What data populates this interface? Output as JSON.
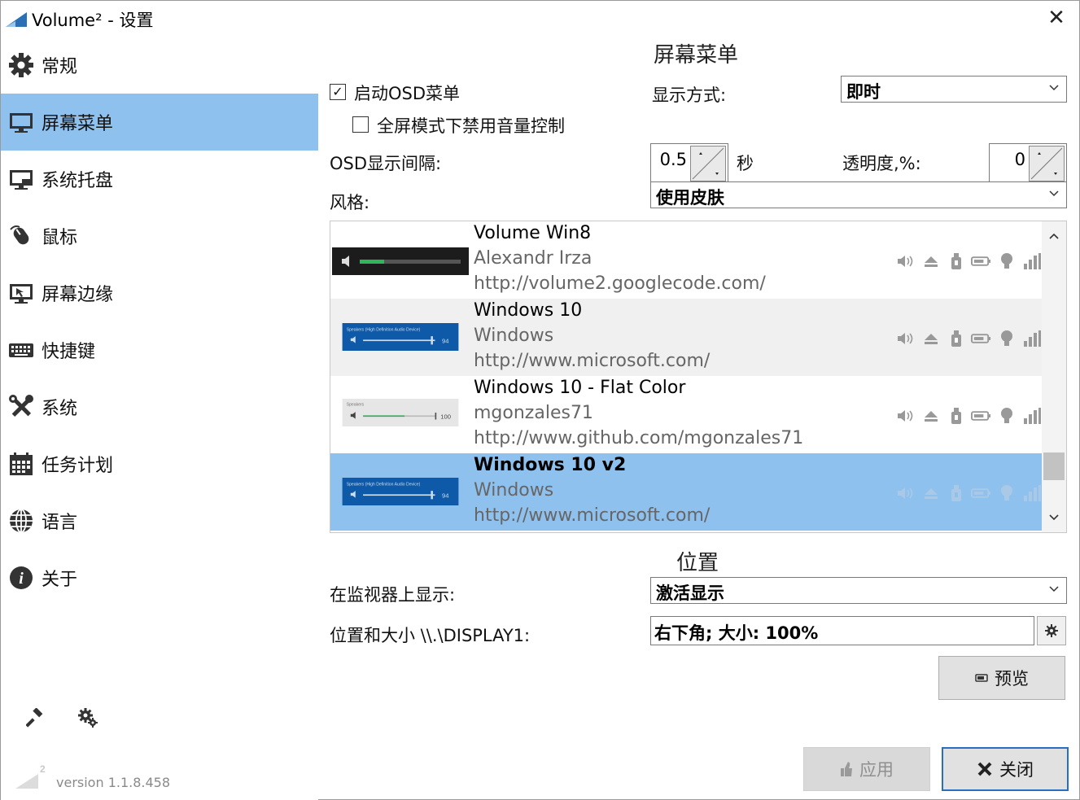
{
  "window": {
    "title": "Volume² - 设置",
    "close_label": "✕"
  },
  "sidebar": {
    "items": [
      {
        "label": "常规",
        "icon": "gear-icon"
      },
      {
        "label": "屏幕菜单",
        "icon": "monitor-icon"
      },
      {
        "label": "系统托盘",
        "icon": "tray-icon"
      },
      {
        "label": "鼠标",
        "icon": "mouse-icon"
      },
      {
        "label": "屏幕边缘",
        "icon": "screen-edge-icon"
      },
      {
        "label": "快捷键",
        "icon": "keyboard-icon"
      },
      {
        "label": "系统",
        "icon": "tools-icon"
      },
      {
        "label": "任务计划",
        "icon": "calendar-icon"
      },
      {
        "label": "语言",
        "icon": "globe-icon"
      },
      {
        "label": "关于",
        "icon": "info-icon"
      }
    ],
    "active_index": 1,
    "version": "version 1.1.8.458"
  },
  "osd": {
    "section_title": "屏幕菜单",
    "enable_label": "启动OSD菜单",
    "enable_checked": true,
    "fullscreen_label": "全屏模式下禁用音量控制",
    "fullscreen_checked": false,
    "display_mode_label": "显示方式:",
    "display_mode_value": "即时",
    "interval_label": "OSD显示间隔:",
    "interval_value": "0.5",
    "interval_unit": "秒",
    "opacity_label": "透明度,%:",
    "opacity_value": "0",
    "style_label": "风格:",
    "style_value": "使用皮肤"
  },
  "skins": [
    {
      "name": "Volume Win8",
      "author": "Alexandr Irza",
      "url": "http://volume2.googlecode.com/",
      "selected": false
    },
    {
      "name": "Windows 10",
      "author": "Windows",
      "url": "http://www.microsoft.com/",
      "selected": false
    },
    {
      "name": "Windows 10 - Flat Color",
      "author": "mgonzales71",
      "url": "http://www.github.com/mgonzales71",
      "selected": false
    },
    {
      "name": "Windows 10 v2",
      "author": "Windows",
      "url": "http://www.microsoft.com/",
      "selected": true
    }
  ],
  "skin_thumbs": {
    "win10_text": "Speakers (High Definition Audio Device)",
    "win10_value": "94",
    "flat_text": "Speakers",
    "flat_value": "100"
  },
  "position": {
    "section_title": "位置",
    "monitor_label": "在监视器上显示:",
    "monitor_value": "激活显示",
    "posize_label": "位置和大小 \\\\.\\DISPLAY1:",
    "posize_value": "右下角; 大小: 100%"
  },
  "buttons": {
    "preview": "预览",
    "apply": "应用",
    "close": "关闭"
  },
  "colors": {
    "accent": "#8fc1ee",
    "focus_border": "#2a6ebf"
  }
}
